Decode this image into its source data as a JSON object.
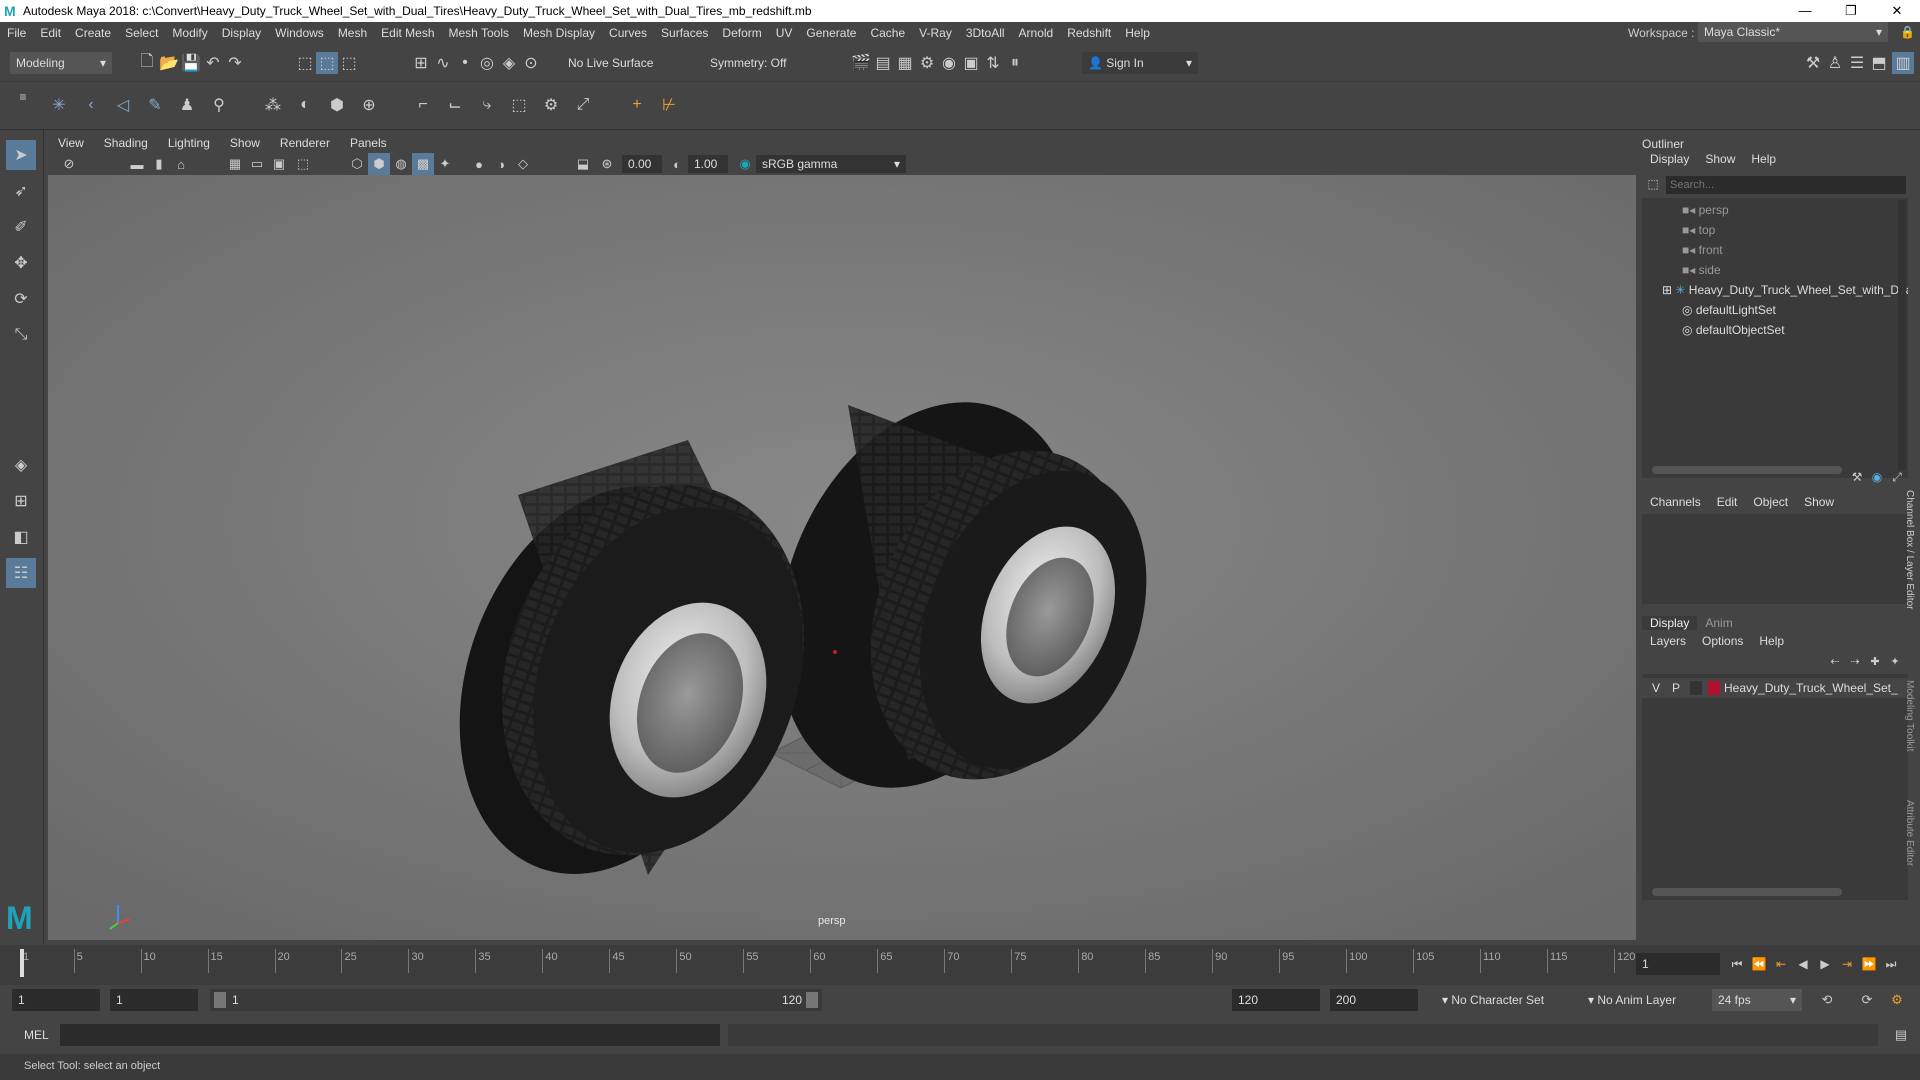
{
  "window": {
    "title": "Autodesk Maya 2018: c:\\Convert\\Heavy_Duty_Truck_Wheel_Set_with_Dual_Tires\\Heavy_Duty_Truck_Wheel_Set_with_Dual_Tires_mb_redshift.mb",
    "logo": "M",
    "minimize": "—",
    "maximize": "❐",
    "close": "✕"
  },
  "menu": [
    "File",
    "Edit",
    "Create",
    "Select",
    "Modify",
    "Display",
    "Windows",
    "Mesh",
    "Edit Mesh",
    "Mesh Tools",
    "Mesh Display",
    "Curves",
    "Surfaces",
    "Deform",
    "UV",
    "Generate",
    "Cache",
    "V-Ray",
    "3DtoAll",
    "Arnold",
    "Redshift",
    "Help"
  ],
  "workspace": {
    "label": "Workspace :",
    "value": "Maya Classic*"
  },
  "status": {
    "mode": "Modeling",
    "live_surface": "No Live Surface",
    "symmetry": "Symmetry: Off",
    "sign_in": "Sign In"
  },
  "viewport": {
    "menus": [
      "View",
      "Shading",
      "Lighting",
      "Show",
      "Renderer",
      "Panels"
    ],
    "exposure": "0.00",
    "gamma": "1.00",
    "color_space": "sRGB gamma",
    "camera_label": "persp"
  },
  "outliner": {
    "title": "Outliner",
    "menus": [
      "Display",
      "Show",
      "Help"
    ],
    "search_placeholder": "Search...",
    "items": [
      {
        "label": "persp",
        "type": "camera"
      },
      {
        "label": "top",
        "type": "camera"
      },
      {
        "label": "front",
        "type": "camera"
      },
      {
        "label": "side",
        "type": "camera"
      },
      {
        "label": "Heavy_Duty_Truck_Wheel_Set_with_Dual",
        "type": "group"
      },
      {
        "label": "defaultLightSet",
        "type": "set"
      },
      {
        "label": "defaultObjectSet",
        "type": "set"
      }
    ]
  },
  "channel_box": {
    "menus": [
      "Channels",
      "Edit",
      "Object",
      "Show"
    ],
    "side_tabs": [
      "Channel Box / Layer Editor",
      "Modeling Toolkit",
      "Attribute Editor"
    ]
  },
  "layer_editor": {
    "tabs": [
      "Display",
      "Anim"
    ],
    "menus": [
      "Layers",
      "Options",
      "Help"
    ],
    "layer": {
      "v": "V",
      "p": "P",
      "name": "Heavy_Duty_Truck_Wheel_Set_",
      "color": "#b0102a"
    }
  },
  "timeline": {
    "ticks": [
      "1",
      "5",
      "10",
      "15",
      "20",
      "25",
      "30",
      "35",
      "40",
      "45",
      "50",
      "55",
      "60",
      "65",
      "70",
      "75",
      "80",
      "85",
      "90",
      "95",
      "100",
      "105",
      "110",
      "115",
      "120"
    ],
    "current_frame": "1"
  },
  "range": {
    "start": "1",
    "playback_start": "1",
    "slider_start": "1",
    "slider_end": "120",
    "playback_end": "120",
    "end": "200",
    "character_set": "No Character Set",
    "anim_layer": "No Anim Layer",
    "fps": "24 fps"
  },
  "command": {
    "label": "MEL"
  },
  "help_line": "Select Tool: select an object"
}
